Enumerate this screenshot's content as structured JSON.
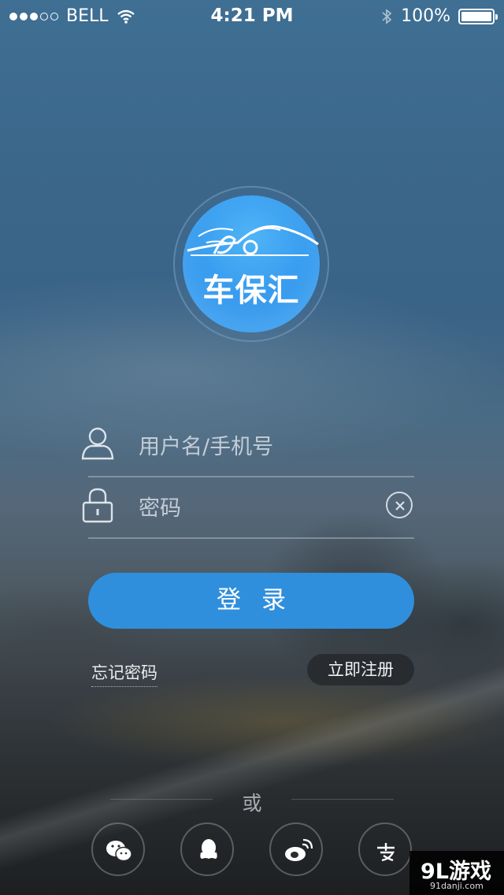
{
  "status_bar": {
    "carrier": "BELL",
    "time": "4:21 PM",
    "battery": "100%"
  },
  "logo": {
    "text": "车保汇"
  },
  "form": {
    "username_placeholder": "用户名/手机号",
    "password_placeholder": "密码",
    "login_label": "登录"
  },
  "links": {
    "forgot": "忘记密码",
    "register": "立即注册"
  },
  "divider": {
    "or": "或"
  },
  "social": [
    "wechat-icon",
    "qq-icon",
    "weibo-icon",
    "alipay-icon"
  ],
  "watermark": {
    "logo": "9L游戏",
    "site": "91danji.com"
  }
}
